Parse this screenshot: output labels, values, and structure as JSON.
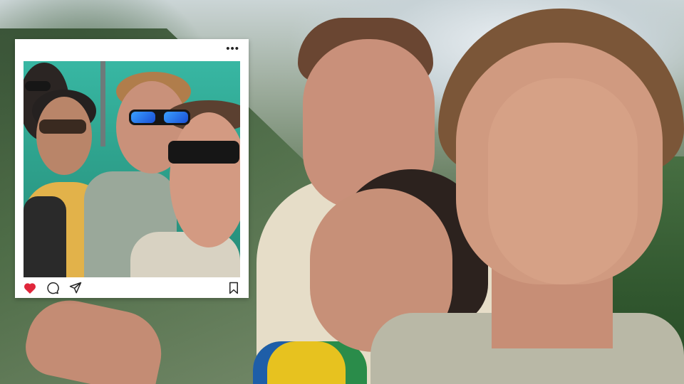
{
  "post": {
    "more_label": "•••",
    "icons": {
      "more": "more-dots-icon",
      "like": "heart-icon",
      "comment": "comment-icon",
      "share": "send-icon",
      "save": "bookmark-icon"
    },
    "liked": true
  },
  "colors": {
    "heart_liked": "#e0263b",
    "icon_stroke": "#262626",
    "card_bg": "#ffffff"
  }
}
